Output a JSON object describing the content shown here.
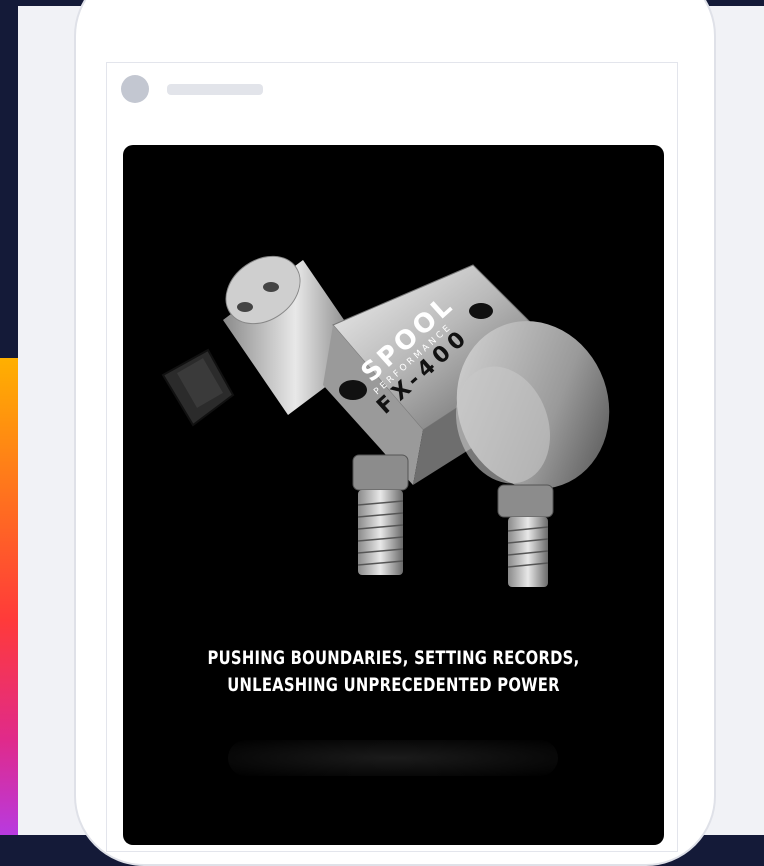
{
  "ad": {
    "headline_line1": "PUSHING BOUNDARIES, SETTING RECORDS,",
    "headline_line2": "UNLEASHING UNPRECEDENTED POWER",
    "product_brand": "SPOOL",
    "product_sub": "PERFORMANCE",
    "product_model": "FX-400"
  },
  "colors": {
    "background": "#141a38",
    "stage": "#f1f2f6",
    "ad_background": "#000000",
    "headline": "#ffffff"
  }
}
